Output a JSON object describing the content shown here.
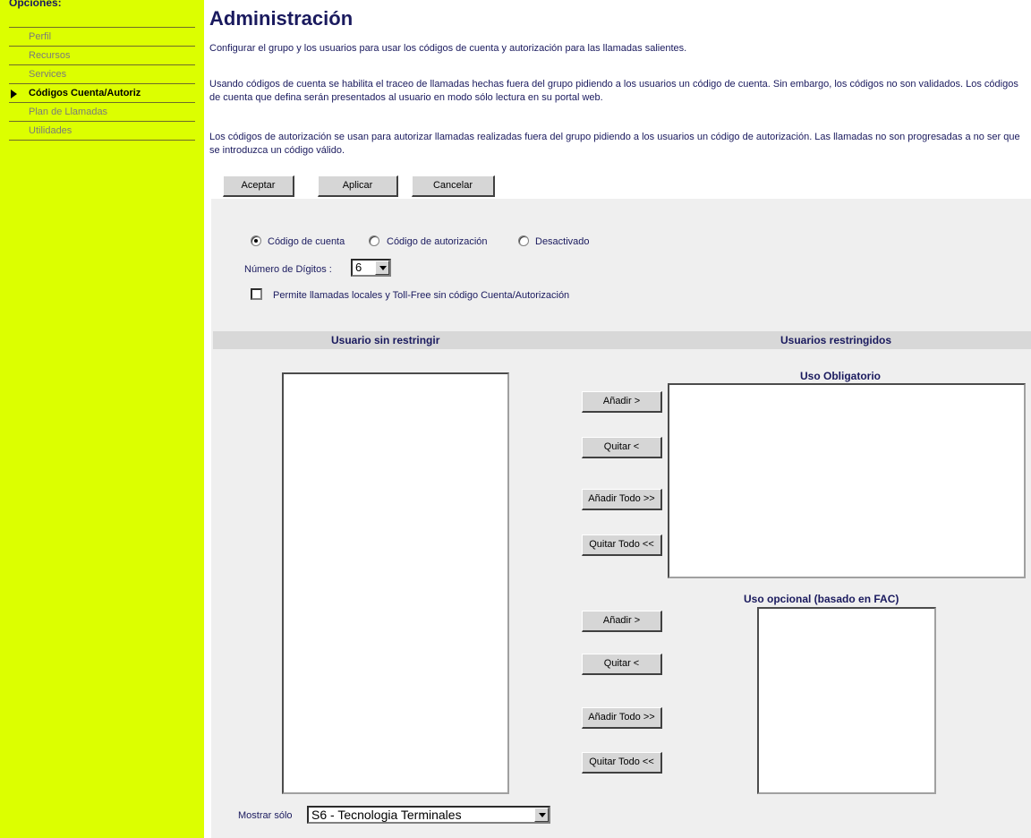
{
  "sidebar": {
    "title": "Opciones:",
    "items": [
      {
        "label": "Perfil"
      },
      {
        "label": "Recursos"
      },
      {
        "label": "Services"
      },
      {
        "label": "Códigos Cuenta/Autoriz"
      },
      {
        "label": "Plan de Llamadas"
      },
      {
        "label": "Utilidades"
      }
    ],
    "active_index": 3
  },
  "main": {
    "title": "Administración",
    "paragraphs": [
      "Configurar el grupo y los usuarios para usar los códigos de cuenta y autorización para las llamadas salientes.",
      "Usando códigos de cuenta se habilita el traceo de llamadas hechas fuera del grupo pidiendo a los usuarios un código de cuenta. Sin embargo, los códigos no son validados. Los códigos de cuenta que defina serán presentados al usuario en modo sólo lectura en su portal web.",
      "Los códigos de autorización se usan para autorizar llamadas realizadas fuera del grupo pidiendo a los usuarios un código de autorización. Las llamadas no son progresadas a no ser que se introduzca un código válido."
    ],
    "buttons": {
      "accept": "Aceptar",
      "apply": "Aplicar",
      "cancel": "Cancelar"
    }
  },
  "form": {
    "radios": [
      {
        "label": "Código de cuenta",
        "selected": true
      },
      {
        "label": "Código de autorización",
        "selected": false
      },
      {
        "label": "Desactivado",
        "selected": false
      }
    ],
    "digits_label": "Número de Dígitos :",
    "digits_value": "6",
    "checkbox_label": "Permite llamadas locales y Toll-Free sin código Cuenta/Autorización",
    "checkbox_checked": false
  },
  "users": {
    "unrestricted_header": "Usuario sin restringir",
    "restricted_header": "Usuarios restringidos",
    "mandatory_header": "Uso Obligatorio",
    "optional_header": "Uso opcional (basado en FAC)",
    "mandatory_buttons": {
      "add": "Añadir >",
      "remove": "Quitar <",
      "add_all": "Añadir Todo >>",
      "remove_all": "Quitar Todo <<"
    },
    "optional_buttons": {
      "add": "Añadir >",
      "remove": "Quitar <",
      "add_all": "Añadir Todo >>",
      "remove_all": "Quitar Todo <<"
    },
    "show_only_label": "Mostrar sólo",
    "show_only_value": "S6 - Tecnologia Terminales"
  }
}
